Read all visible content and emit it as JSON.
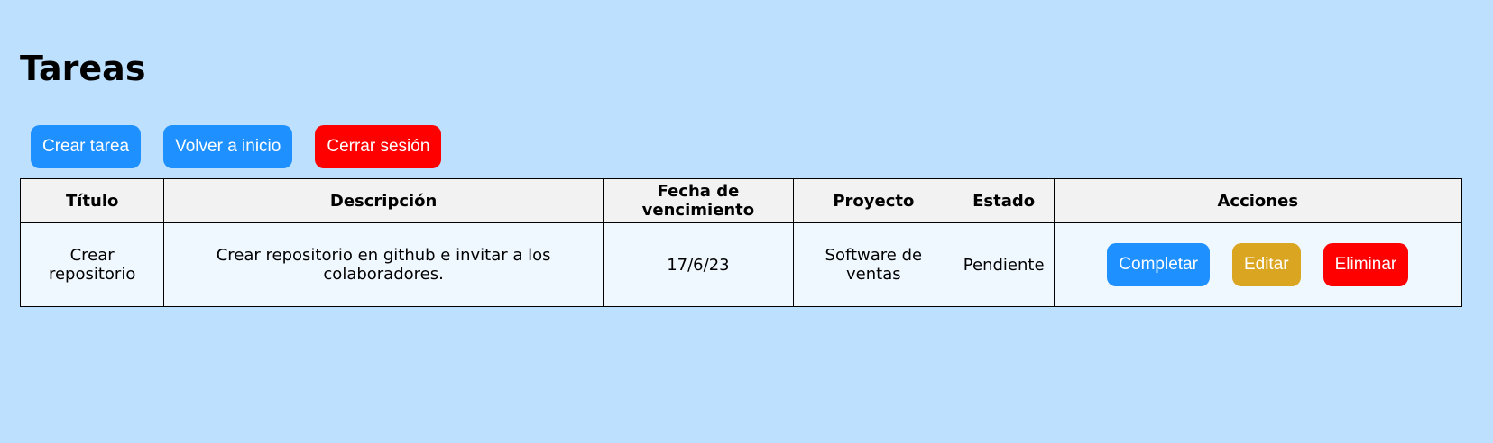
{
  "page": {
    "title": "Tareas"
  },
  "toolbar": {
    "create_label": "Crear tarea",
    "home_label": "Volver a inicio",
    "logout_label": "Cerrar sesión"
  },
  "table": {
    "headers": [
      "Título",
      "Descripción",
      "Fecha de vencimiento",
      "Proyecto",
      "Estado",
      "Acciones"
    ],
    "rows": [
      {
        "title": "Crear repositorio",
        "description": "Crear repositorio en github e invitar a los colaboradores.",
        "due_date": "17/6/23",
        "project": "Software de ventas",
        "status": "Pendiente",
        "actions": {
          "complete_label": "Completar",
          "edit_label": "Editar",
          "delete_label": "Eliminar"
        }
      }
    ]
  },
  "colors": {
    "background": "#bde0fe",
    "primary": "#1e90ff",
    "danger": "#ff0000",
    "warning": "#daa520",
    "header_bg": "#f2f2f2",
    "row_bg": "#f0f8ff"
  }
}
